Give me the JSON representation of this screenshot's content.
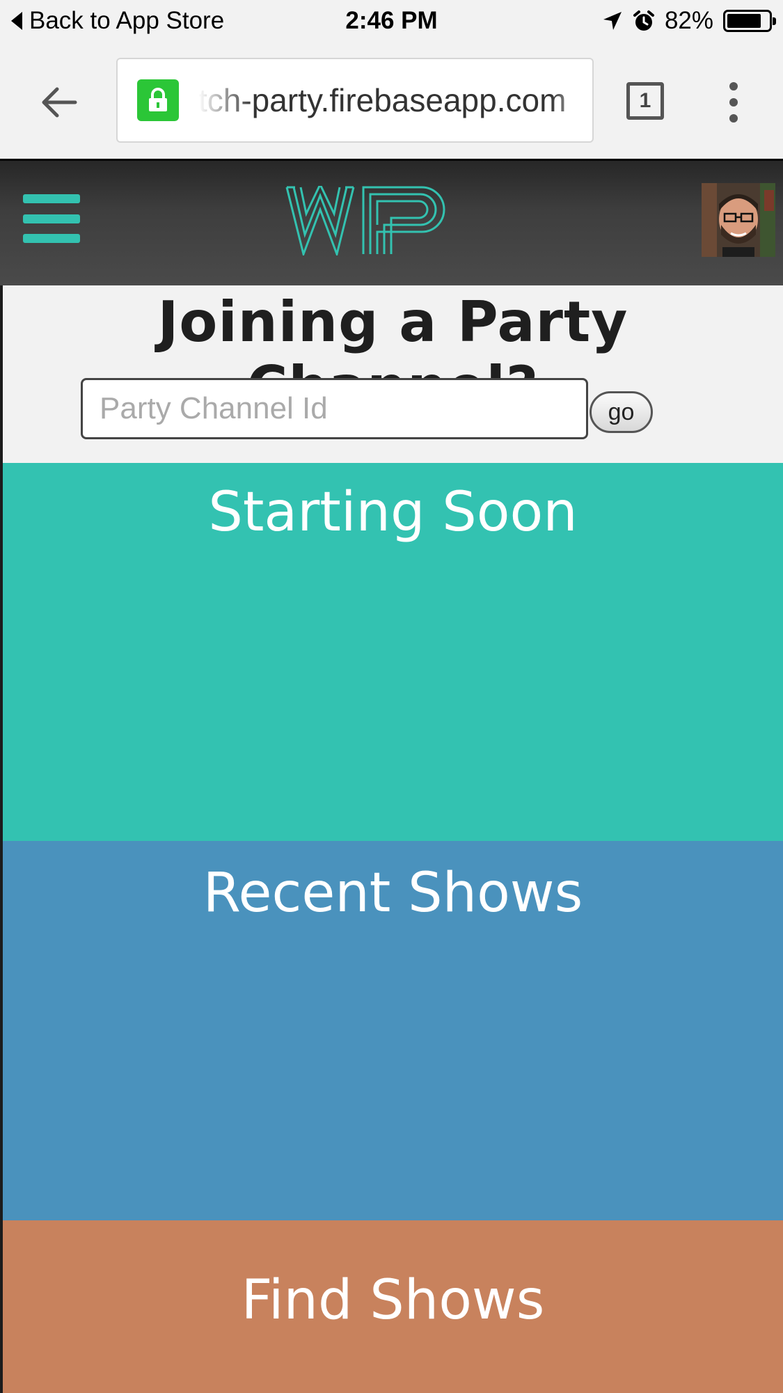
{
  "status_bar": {
    "back_label": "Back to App Store",
    "time": "2:46 PM",
    "battery": "82%",
    "battery_level": 0.82
  },
  "browser": {
    "url": "tch-party.firebaseapp.com",
    "tab_count": "1"
  },
  "header": {
    "logo_text": "WP",
    "accent_color": "#33c2b0"
  },
  "join": {
    "title": "Joining a Party Channel?",
    "input_placeholder": "Party Channel Id",
    "input_value": "",
    "go_label": "go"
  },
  "sections": {
    "starting_soon": "Starting Soon",
    "recent_shows": "Recent Shows",
    "find_shows": "Find Shows"
  },
  "colors": {
    "starting_soon": "#33c2b1",
    "recent_shows": "#4a92bd",
    "find_shows": "#c8825d"
  }
}
